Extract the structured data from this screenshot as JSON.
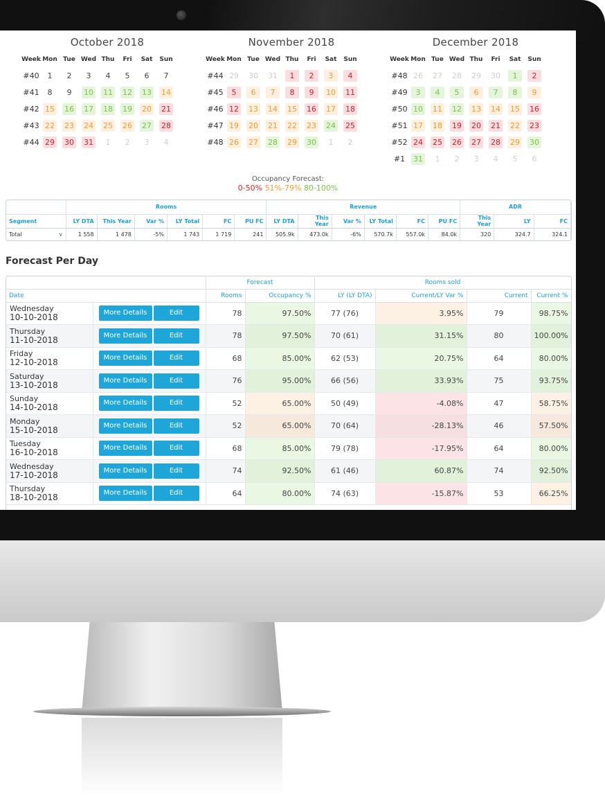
{
  "calendars": [
    {
      "title": "October 2018",
      "headers": [
        "Week",
        "Mon",
        "Tue",
        "Wed",
        "Thu",
        "Fri",
        "Sat",
        "Sun"
      ],
      "rows": [
        {
          "week": "#40",
          "days": [
            [
              "1",
              "plain"
            ],
            [
              "2",
              "plain"
            ],
            [
              "3",
              "plain"
            ],
            [
              "4",
              "plain"
            ],
            [
              "5",
              "plain"
            ],
            [
              "6",
              "plain"
            ],
            [
              "7",
              "plain"
            ]
          ]
        },
        {
          "week": "#41",
          "days": [
            [
              "8",
              "plain"
            ],
            [
              "9",
              "plain"
            ],
            [
              "10",
              "green"
            ],
            [
              "11",
              "green"
            ],
            [
              "12",
              "green"
            ],
            [
              "13",
              "green"
            ],
            [
              "14",
              "orange"
            ]
          ]
        },
        {
          "week": "#42",
          "days": [
            [
              "15",
              "orange"
            ],
            [
              "16",
              "green"
            ],
            [
              "17",
              "green"
            ],
            [
              "18",
              "green"
            ],
            [
              "19",
              "green"
            ],
            [
              "20",
              "orange"
            ],
            [
              "21",
              "red"
            ]
          ]
        },
        {
          "week": "#43",
          "days": [
            [
              "22",
              "orange"
            ],
            [
              "23",
              "orange"
            ],
            [
              "24",
              "orange"
            ],
            [
              "25",
              "orange"
            ],
            [
              "26",
              "orange"
            ],
            [
              "27",
              "green"
            ],
            [
              "28",
              "red"
            ]
          ]
        },
        {
          "week": "#44",
          "days": [
            [
              "29",
              "red"
            ],
            [
              "30",
              "red"
            ],
            [
              "31",
              "red"
            ],
            [
              "1",
              "muted"
            ],
            [
              "2",
              "muted"
            ],
            [
              "3",
              "muted"
            ],
            [
              "4",
              "muted"
            ]
          ]
        }
      ]
    },
    {
      "title": "November 2018",
      "headers": [
        "Week",
        "Mon",
        "Tue",
        "Wed",
        "Thu",
        "Fri",
        "Sat",
        "Sun"
      ],
      "rows": [
        {
          "week": "#44",
          "days": [
            [
              "29",
              "muted"
            ],
            [
              "30",
              "muted"
            ],
            [
              "31",
              "muted"
            ],
            [
              "1",
              "red"
            ],
            [
              "2",
              "red"
            ],
            [
              "3",
              "orange"
            ],
            [
              "4",
              "red"
            ]
          ]
        },
        {
          "week": "#45",
          "days": [
            [
              "5",
              "red"
            ],
            [
              "6",
              "orange"
            ],
            [
              "7",
              "orange"
            ],
            [
              "8",
              "red"
            ],
            [
              "9",
              "red"
            ],
            [
              "10",
              "orange"
            ],
            [
              "11",
              "red"
            ]
          ]
        },
        {
          "week": "#46",
          "days": [
            [
              "12",
              "red"
            ],
            [
              "13",
              "orange"
            ],
            [
              "14",
              "orange"
            ],
            [
              "15",
              "orange"
            ],
            [
              "16",
              "red"
            ],
            [
              "17",
              "orange"
            ],
            [
              "18",
              "red"
            ]
          ]
        },
        {
          "week": "#47",
          "days": [
            [
              "19",
              "orange"
            ],
            [
              "20",
              "orange"
            ],
            [
              "21",
              "orange"
            ],
            [
              "22",
              "orange"
            ],
            [
              "23",
              "orange"
            ],
            [
              "24",
              "green"
            ],
            [
              "25",
              "red"
            ]
          ]
        },
        {
          "week": "#48",
          "days": [
            [
              "26",
              "orange"
            ],
            [
              "27",
              "orange"
            ],
            [
              "28",
              "green"
            ],
            [
              "29",
              "orange"
            ],
            [
              "30",
              "green"
            ],
            [
              "1",
              "muted"
            ],
            [
              "2",
              "muted"
            ]
          ]
        }
      ]
    },
    {
      "title": "December 2018",
      "headers": [
        "Week",
        "Mon",
        "Tue",
        "Wed",
        "Thu",
        "Fri",
        "Sat",
        "Sun"
      ],
      "rows": [
        {
          "week": "#48",
          "days": [
            [
              "26",
              "muted"
            ],
            [
              "27",
              "muted"
            ],
            [
              "28",
              "muted"
            ],
            [
              "29",
              "muted"
            ],
            [
              "30",
              "muted"
            ],
            [
              "1",
              "green"
            ],
            [
              "2",
              "red"
            ]
          ]
        },
        {
          "week": "#49",
          "days": [
            [
              "3",
              "green"
            ],
            [
              "4",
              "green"
            ],
            [
              "5",
              "green"
            ],
            [
              "6",
              "orange"
            ],
            [
              "7",
              "green"
            ],
            [
              "8",
              "green"
            ],
            [
              "9",
              "orange"
            ]
          ]
        },
        {
          "week": "#50",
          "days": [
            [
              "10",
              "green"
            ],
            [
              "11",
              "orange"
            ],
            [
              "12",
              "green"
            ],
            [
              "13",
              "orange"
            ],
            [
              "14",
              "orange"
            ],
            [
              "15",
              "orange"
            ],
            [
              "16",
              "red"
            ]
          ]
        },
        {
          "week": "#51",
          "days": [
            [
              "17",
              "orange"
            ],
            [
              "18",
              "orange"
            ],
            [
              "19",
              "red"
            ],
            [
              "20",
              "red"
            ],
            [
              "21",
              "red"
            ],
            [
              "22",
              "orange"
            ],
            [
              "23",
              "red"
            ]
          ]
        },
        {
          "week": "#52",
          "days": [
            [
              "24",
              "red"
            ],
            [
              "25",
              "red"
            ],
            [
              "26",
              "red"
            ],
            [
              "27",
              "red"
            ],
            [
              "28",
              "red"
            ],
            [
              "29",
              "orange"
            ],
            [
              "30",
              "green"
            ]
          ]
        },
        {
          "week": "#1",
          "days": [
            [
              "31",
              "green"
            ],
            [
              "1",
              "muted"
            ],
            [
              "2",
              "muted"
            ],
            [
              "3",
              "muted"
            ],
            [
              "4",
              "muted"
            ],
            [
              "5",
              "muted"
            ],
            [
              "6",
              "muted"
            ]
          ]
        }
      ]
    }
  ],
  "legend": {
    "title": "Occupancy Forecast:",
    "ranges": [
      {
        "label": "0-50%",
        "color": "#e01f26"
      },
      {
        "label": "51%-79%",
        "color": "#f39b2c"
      },
      {
        "label": "80-100%",
        "color": "#7cc242"
      }
    ]
  },
  "segment_table": {
    "groups": {
      "rooms": "Rooms",
      "revenue": "Revenue",
      "adr": "ADR"
    },
    "columns": [
      "Segment",
      "LY DTA",
      "This Year",
      "Var %",
      "LY Total",
      "FC",
      "PU FC",
      "LY DTA",
      "This Year",
      "Var %",
      "LY Total",
      "FC",
      "PU FC",
      "This Year",
      "LY",
      "FC"
    ],
    "row": [
      "Total",
      "1 558",
      "1 478",
      "-5%",
      "1 743",
      "1 719",
      "241",
      "505.9k",
      "473.0k",
      "-6%",
      "570.7k",
      "557.0k",
      "84.0k",
      "320",
      "324.7",
      "324.1"
    ]
  },
  "section_title": "Forecast Per Day",
  "forecast_table": {
    "groups": {
      "forecast": "Forecast",
      "rooms_sold": "Rooms sold"
    },
    "columns": {
      "date": "Date",
      "rooms": "Rooms",
      "occupancy": "Occupancy %",
      "ly": "LY (LY DTA)",
      "var": "Current/LY Var %",
      "current": "Current",
      "current_pct": "Current %"
    },
    "buttons": {
      "more": "More Details",
      "edit": "Edit"
    },
    "rows": [
      {
        "day": "Wednesday",
        "date": "10-10-2018",
        "rooms": "78",
        "occ": "97.50%",
        "occ_c": "green",
        "ly": "77 (76)",
        "var": "3.95%",
        "var_c": "orange",
        "cur": "79",
        "cur_pct": "98.75%",
        "cur_c": "green"
      },
      {
        "day": "Thursday",
        "date": "11-10-2018",
        "rooms": "78",
        "occ": "97.50%",
        "occ_c": "green",
        "ly": "70 (61)",
        "var": "31.15%",
        "var_c": "green",
        "cur": "80",
        "cur_pct": "100.00%",
        "cur_c": "green"
      },
      {
        "day": "Friday",
        "date": "12-10-2018",
        "rooms": "68",
        "occ": "85.00%",
        "occ_c": "green",
        "ly": "62 (53)",
        "var": "20.75%",
        "var_c": "green",
        "cur": "64",
        "cur_pct": "80.00%",
        "cur_c": "green"
      },
      {
        "day": "Saturday",
        "date": "13-10-2018",
        "rooms": "76",
        "occ": "95.00%",
        "occ_c": "green",
        "ly": "66 (56)",
        "var": "33.93%",
        "var_c": "green",
        "cur": "75",
        "cur_pct": "93.75%",
        "cur_c": "green"
      },
      {
        "day": "Sunday",
        "date": "14-10-2018",
        "rooms": "52",
        "occ": "65.00%",
        "occ_c": "orange",
        "ly": "50 (49)",
        "var": "-4.08%",
        "var_c": "red",
        "cur": "47",
        "cur_pct": "58.75%",
        "cur_c": "orange"
      },
      {
        "day": "Monday",
        "date": "15-10-2018",
        "rooms": "52",
        "occ": "65.00%",
        "occ_c": "orange",
        "ly": "70 (64)",
        "var": "-28.13%",
        "var_c": "red",
        "cur": "46",
        "cur_pct": "57.50%",
        "cur_c": "orange"
      },
      {
        "day": "Tuesday",
        "date": "16-10-2018",
        "rooms": "68",
        "occ": "85.00%",
        "occ_c": "green",
        "ly": "79 (78)",
        "var": "-17.95%",
        "var_c": "red",
        "cur": "64",
        "cur_pct": "80.00%",
        "cur_c": "green"
      },
      {
        "day": "Wednesday",
        "date": "17-10-2018",
        "rooms": "74",
        "occ": "92.50%",
        "occ_c": "green",
        "ly": "61 (46)",
        "var": "60.87%",
        "var_c": "green",
        "cur": "74",
        "cur_pct": "92.50%",
        "cur_c": "green"
      },
      {
        "day": "Thursday",
        "date": "18-10-2018",
        "rooms": "64",
        "occ": "80.00%",
        "occ_c": "green",
        "ly": "74 (63)",
        "var": "-15.87%",
        "var_c": "red",
        "cur": "53",
        "cur_pct": "66.25%",
        "cur_c": "orange"
      }
    ]
  },
  "colors": {
    "accent": "#1ea6d8",
    "red": "#e01f26",
    "orange": "#f39b2c",
    "green": "#7cc242"
  }
}
